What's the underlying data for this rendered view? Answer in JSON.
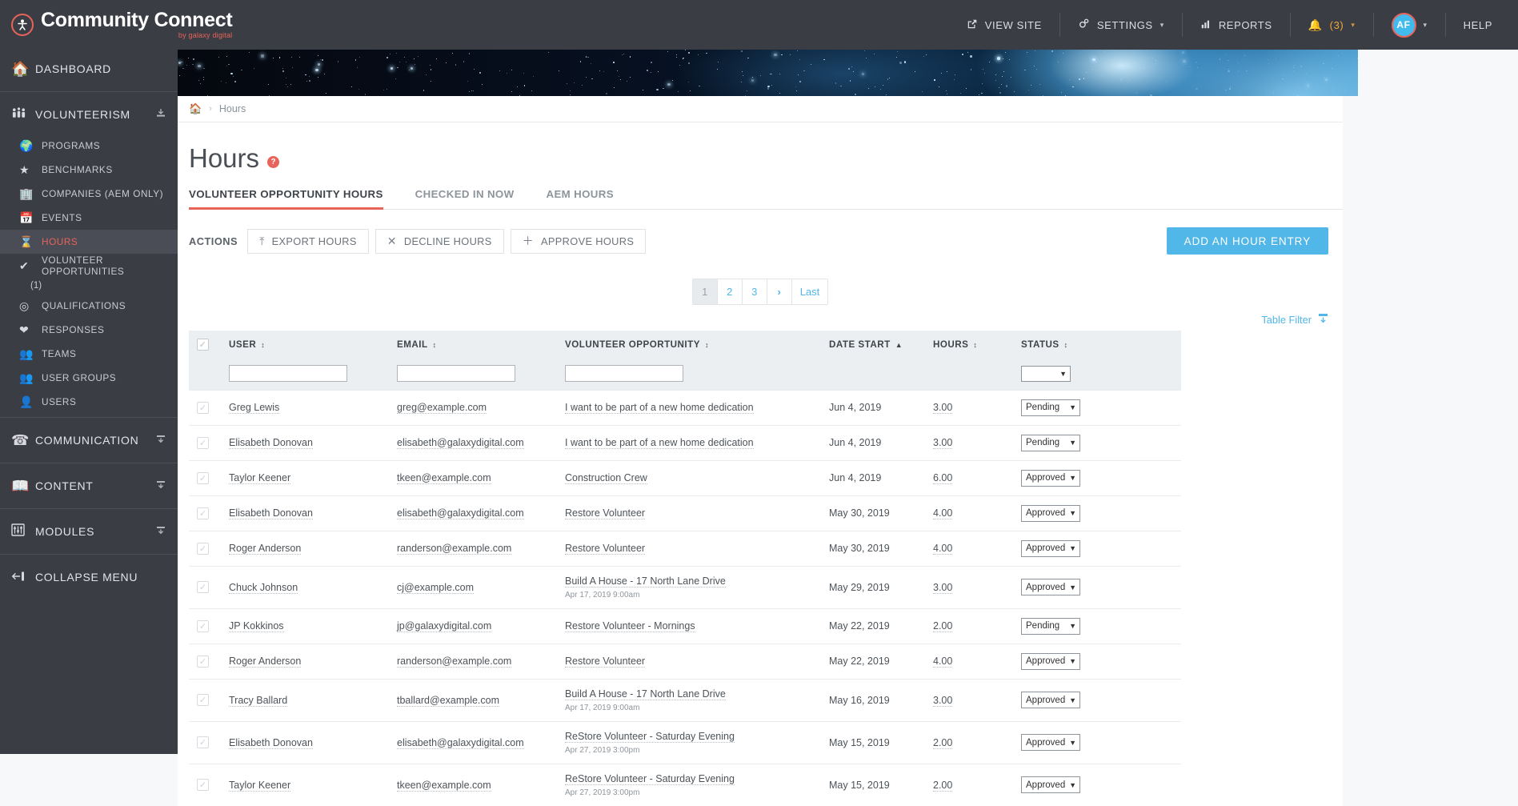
{
  "brand": {
    "title": "Community Connect",
    "subtitle": "by galaxy digital",
    "mark": "person-icon"
  },
  "topnav": {
    "view_site": "VIEW SITE",
    "settings": "SETTINGS",
    "reports": "REPORTS",
    "notifications_count": "(3)",
    "avatar_initials": "AF",
    "help": "HELP",
    "caret": "▾"
  },
  "sidebar": {
    "dashboard": {
      "label": "DASHBOARD",
      "icon": "home-icon"
    },
    "volunteerism": {
      "label": "VOLUNTEERISM",
      "icon": "people-icon",
      "right_icon": "collapse-icon"
    },
    "items": [
      {
        "label": "PROGRAMS",
        "icon": "hand-globe-icon"
      },
      {
        "label": "BENCHMARKS",
        "icon": "star-icon"
      },
      {
        "label": "COMPANIES (AEM ONLY)",
        "icon": "building-icon"
      },
      {
        "label": "EVENTS",
        "icon": "calendar-icon"
      },
      {
        "label": "HOURS",
        "icon": "hourglass-icon",
        "active": true
      },
      {
        "label": "VOLUNTEER OPPORTUNITIES",
        "icon": "check-circle-icon",
        "count": "(1)"
      },
      {
        "label": "QUALIFICATIONS",
        "icon": "target-icon"
      },
      {
        "label": "RESPONSES",
        "icon": "hands-heart-icon"
      },
      {
        "label": "TEAMS",
        "icon": "teams-icon"
      },
      {
        "label": "USER GROUPS",
        "icon": "users-icon"
      },
      {
        "label": "USERS",
        "icon": "user-icon"
      }
    ],
    "communication": {
      "label": "COMMUNICATION",
      "icon": "phone-icon",
      "right_icon": "collapse-icon"
    },
    "content": {
      "label": "CONTENT",
      "icon": "book-icon",
      "right_icon": "collapse-icon"
    },
    "modules": {
      "label": "MODULES",
      "icon": "sliders-icon",
      "right_icon": "collapse-icon"
    },
    "collapse": {
      "label": "COLLAPSE MENU",
      "icon": "arrow-left-icon"
    }
  },
  "breadcrumb": {
    "home_icon": "home-icon",
    "separator": "›",
    "current": "Hours"
  },
  "page": {
    "title": "Hours",
    "help_glyph": "?",
    "tabs": [
      {
        "label": "VOLUNTEER OPPORTUNITY HOURS",
        "active": true
      },
      {
        "label": "CHECKED IN NOW",
        "active": false
      },
      {
        "label": "AEM HOURS",
        "active": false
      }
    ]
  },
  "actions": {
    "label": "ACTIONS",
    "buttons": [
      {
        "label": "EXPORT HOURS",
        "icon": "export-icon",
        "glyph": "⤒"
      },
      {
        "label": "DECLINE HOURS",
        "icon": "close-icon",
        "glyph": "✕"
      },
      {
        "label": "APPROVE HOURS",
        "icon": "plus-icon",
        "glyph": "＋"
      }
    ],
    "primary": {
      "label": "ADD AN HOUR ENTRY",
      "color": "#51b6e8"
    }
  },
  "pagination": {
    "pages": [
      "1",
      "2",
      "3"
    ],
    "current": "1",
    "next": "›",
    "last": "Last"
  },
  "table_filter": {
    "label": "Table Filter",
    "icon": "filter-icon"
  },
  "table": {
    "columns": [
      {
        "key": "user",
        "label": "USER",
        "sort": "↕"
      },
      {
        "key": "email",
        "label": "EMAIL",
        "sort": "↕"
      },
      {
        "key": "opportunity",
        "label": "VOLUNTEER OPPORTUNITY",
        "sort": "↕"
      },
      {
        "key": "date_start",
        "label": "DATE START",
        "sort": "▲"
      },
      {
        "key": "hours",
        "label": "HOURS",
        "sort": "↕"
      },
      {
        "key": "status",
        "label": "STATUS",
        "sort": "↕"
      }
    ],
    "filter_placeholders": {
      "user": "",
      "email": "",
      "opportunity": "",
      "status": ""
    },
    "status_options": [
      "",
      "Pending",
      "Approved"
    ],
    "checkbox_glyph": "✓",
    "rows": [
      {
        "user": "Greg Lewis",
        "email": "greg@example.com",
        "opportunity": "I want to be part of a new home dedication",
        "opportunity_sub": "",
        "date_start": "Jun 4, 2019",
        "hours": "3.00",
        "status": "Pending"
      },
      {
        "user": "Elisabeth Donovan",
        "email": "elisabeth@galaxydigital.com",
        "opportunity": "I want to be part of a new home dedication",
        "opportunity_sub": "",
        "date_start": "Jun 4, 2019",
        "hours": "3.00",
        "status": "Pending"
      },
      {
        "user": "Taylor Keener",
        "email": "tkeen@example.com",
        "opportunity": "Construction Crew",
        "opportunity_sub": "",
        "date_start": "Jun 4, 2019",
        "hours": "6.00",
        "status": "Approved"
      },
      {
        "user": "Elisabeth Donovan",
        "email": "elisabeth@galaxydigital.com",
        "opportunity": "Restore Volunteer",
        "opportunity_sub": "",
        "date_start": "May 30, 2019",
        "hours": "4.00",
        "status": "Approved"
      },
      {
        "user": "Roger Anderson",
        "email": "randerson@example.com",
        "opportunity": "Restore Volunteer",
        "opportunity_sub": "",
        "date_start": "May 30, 2019",
        "hours": "4.00",
        "status": "Approved"
      },
      {
        "user": "Chuck Johnson",
        "email": "cj@example.com",
        "opportunity": "Build A House - 17 North Lane Drive",
        "opportunity_sub": "Apr 17, 2019 9:00am",
        "date_start": "May 29, 2019",
        "hours": "3.00",
        "status": "Approved"
      },
      {
        "user": "JP Kokkinos",
        "email": "jp@galaxydigital.com",
        "opportunity": "Restore Volunteer - Mornings",
        "opportunity_sub": "",
        "date_start": "May 22, 2019",
        "hours": "2.00",
        "status": "Pending"
      },
      {
        "user": "Roger Anderson",
        "email": "randerson@example.com",
        "opportunity": "Restore Volunteer",
        "opportunity_sub": "",
        "date_start": "May 22, 2019",
        "hours": "4.00",
        "status": "Approved"
      },
      {
        "user": "Tracy Ballard",
        "email": "tballard@example.com",
        "opportunity": "Build A House - 17 North Lane Drive",
        "opportunity_sub": "Apr 17, 2019 9:00am",
        "date_start": "May 16, 2019",
        "hours": "3.00",
        "status": "Approved"
      },
      {
        "user": "Elisabeth Donovan",
        "email": "elisabeth@galaxydigital.com",
        "opportunity": "ReStore Volunteer - Saturday Evening",
        "opportunity_sub": "Apr 27, 2019 3:00pm",
        "date_start": "May 15, 2019",
        "hours": "2.00",
        "status": "Approved"
      },
      {
        "user": "Taylor Keener",
        "email": "tkeen@example.com",
        "opportunity": "ReStore Volunteer - Saturday Evening",
        "opportunity_sub": "Apr 27, 2019 3:00pm",
        "date_start": "May 15, 2019",
        "hours": "2.00",
        "status": "Approved"
      }
    ]
  },
  "colors": {
    "accent_red": "#e8635a",
    "accent_blue": "#51b6e8",
    "topbar": "#3b3d45"
  }
}
